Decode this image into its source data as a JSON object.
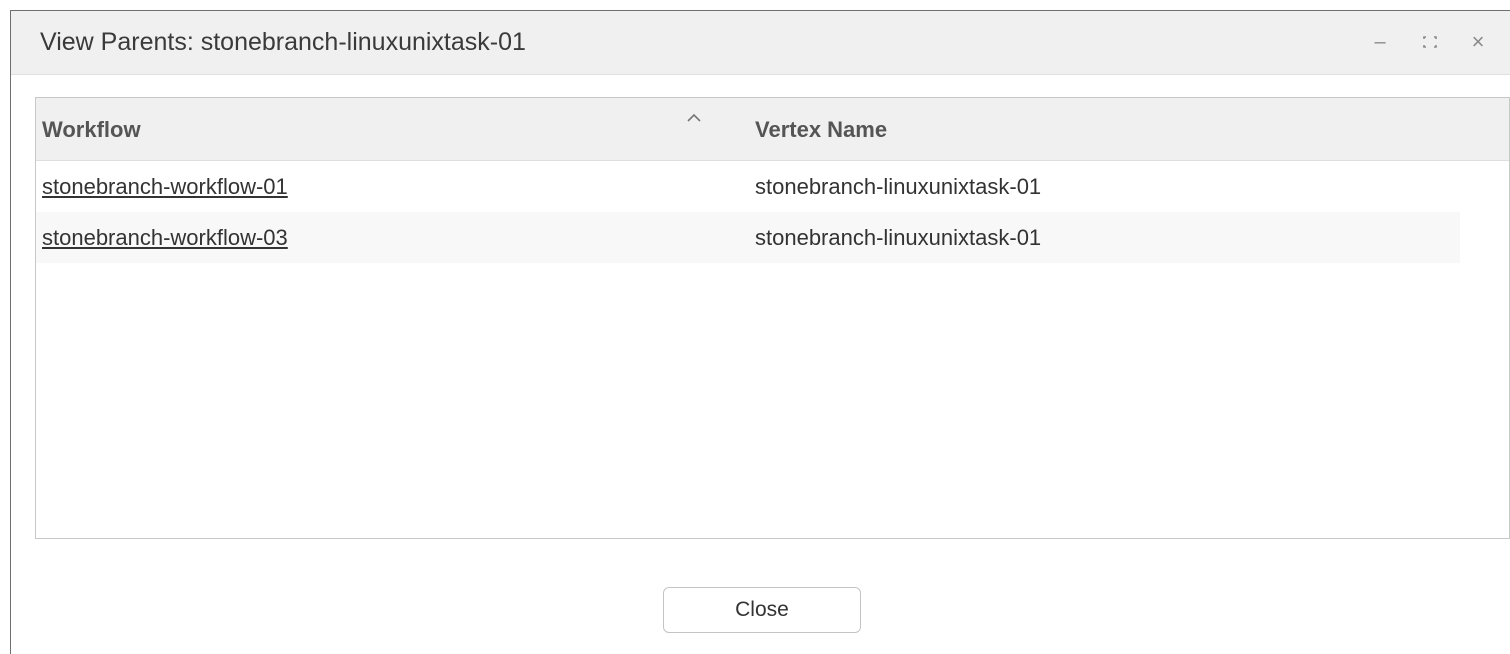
{
  "dialog": {
    "title": "View Parents: stonebranch-linuxunixtask-01",
    "controls": {
      "minimize_glyph": "–",
      "maximize_glyph": "⛶",
      "close_glyph": "×"
    }
  },
  "grid": {
    "columns": [
      {
        "label": "Workflow",
        "sort": "ascending"
      },
      {
        "label": "Vertex Name"
      }
    ],
    "rows": [
      {
        "workflow": "stonebranch-workflow-01",
        "vertex_name": "stonebranch-linuxunixtask-01"
      },
      {
        "workflow": "stonebranch-workflow-03",
        "vertex_name": "stonebranch-linuxunixtask-01"
      }
    ]
  },
  "footer": {
    "close_label": "Close"
  },
  "colors": {
    "title_bar": "#f0f0f0",
    "header_bg": "#f0f0f0",
    "alt_row": "#f8f8f8",
    "text": "#333333"
  }
}
